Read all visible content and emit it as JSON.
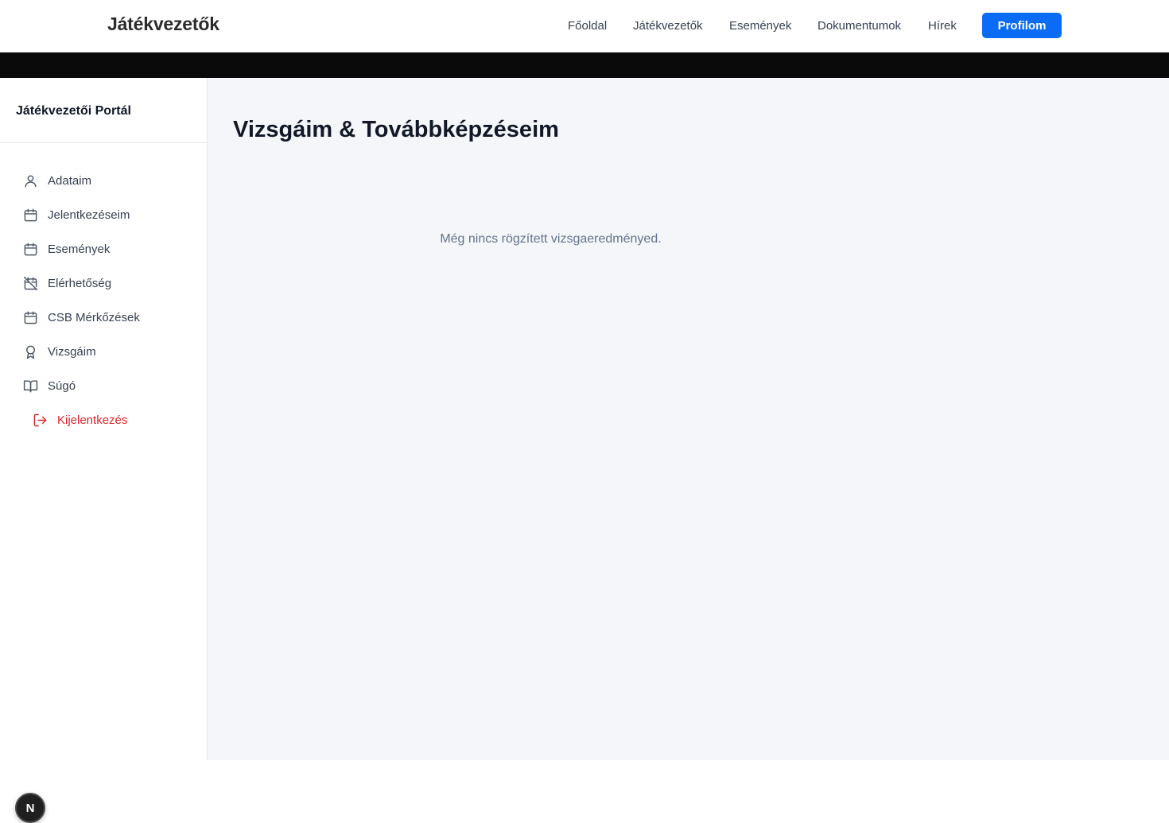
{
  "topbar": {
    "brand": "Játékvezetők",
    "nav": [
      "Főoldal",
      "Játékvezetők",
      "Események",
      "Dokumentumok",
      "Hírek"
    ],
    "profile_button": "Profilom",
    "accent_color": "#0a6cf5"
  },
  "sidebar": {
    "title": "Játékvezetői Portál",
    "items": [
      {
        "label": "Adataim",
        "icon": "user-icon"
      },
      {
        "label": "Jelentkezéseim",
        "icon": "calendar-icon"
      },
      {
        "label": "Események",
        "icon": "calendar-icon"
      },
      {
        "label": "Elérhetőség",
        "icon": "calendar-off-icon"
      },
      {
        "label": "CSB Mérkőzések",
        "icon": "calendar-icon"
      },
      {
        "label": "Vizsgáim",
        "icon": "award-icon"
      },
      {
        "label": "Súgó",
        "icon": "book-icon"
      }
    ],
    "logout": {
      "label": "Kijelentkezés",
      "icon": "logout-icon",
      "color": "#dc2626"
    }
  },
  "badge": {
    "label": "N"
  },
  "main": {
    "title": "Vizsgáim & Továbbképzéseim",
    "empty_message": "Még nincs rögzített vizsgaeredményed."
  }
}
